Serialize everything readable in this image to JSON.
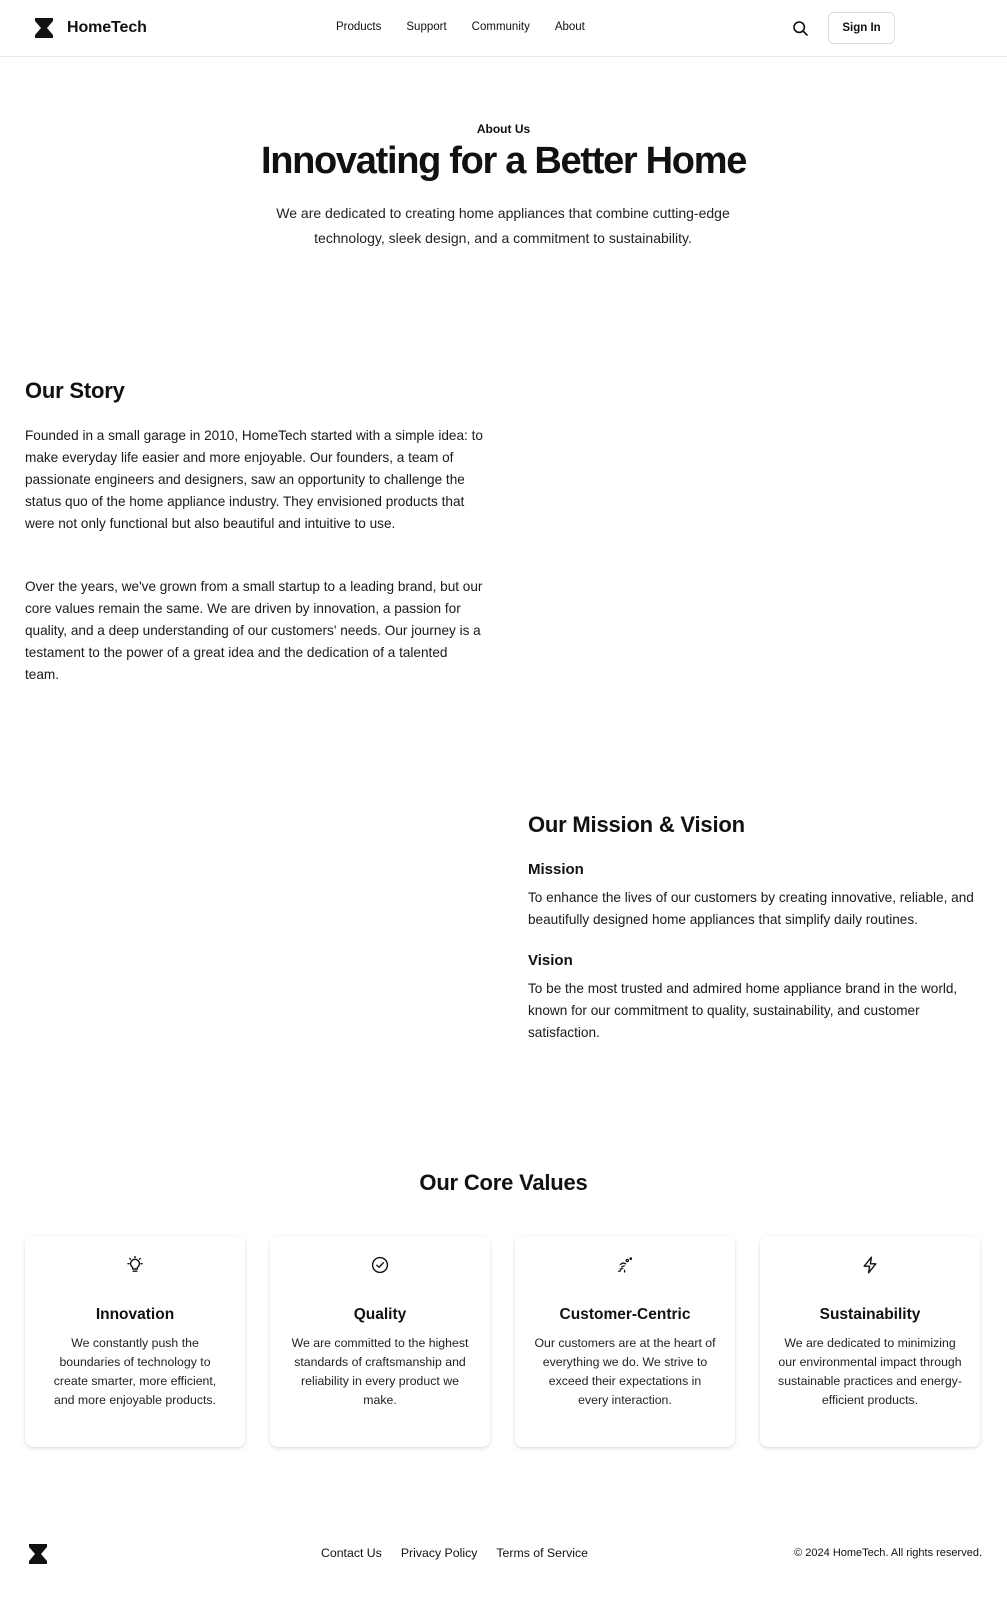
{
  "brand": {
    "name": "HomeTech",
    "logo_icon": "hourglass-logo-icon"
  },
  "nav": {
    "items": [
      {
        "label": "Products"
      },
      {
        "label": "Support"
      },
      {
        "label": "Community"
      },
      {
        "label": "About"
      }
    ],
    "search_icon": "search-icon",
    "signin_label": "Sign In"
  },
  "hero": {
    "eyebrow": "About Us",
    "title": "Innovating for a Better Home",
    "subtitle": "We are dedicated to creating home appliances that combine cutting-edge technology, sleek design, and a commitment to sustainability."
  },
  "story": {
    "title": "Our Story",
    "paragraphs": [
      "Founded in a small garage in 2010, HomeTech started with a simple idea: to make everyday life easier and more enjoyable. Our founders, a team of passionate engineers and designers, saw an opportunity to challenge the status quo of the home appliance industry. They envisioned products that were not only functional but also beautiful and intuitive to use.",
      "Over the years, we've grown from a small startup to a leading brand, but our core values remain the same. We are driven by innovation, a passion for quality, and a deep understanding of our customers' needs. Our journey is a testament to the power of a great idea and the dedication of a talented team."
    ]
  },
  "mission_vision": {
    "title": "Our Mission & Vision",
    "mission_heading": "Mission",
    "mission_text": "To enhance the lives of our customers by creating innovative, reliable, and beautifully designed home appliances that simplify daily routines.",
    "vision_heading": "Vision",
    "vision_text": "To be the most trusted and admired home appliance brand in the world, known for our commitment to quality, sustainability, and customer satisfaction."
  },
  "values": {
    "title": "Our Core Values",
    "cards": [
      {
        "icon": "lightbulb-icon",
        "title": "Innovation",
        "description": "We constantly push the boundaries of technology to create smarter, more efficient, and more enjoyable products."
      },
      {
        "icon": "check-circle-icon",
        "title": "Quality",
        "description": "We are committed to the highest standards of craftsmanship and reliability in every product we make."
      },
      {
        "icon": "handshake-icon",
        "title": "Customer-Centric",
        "description": "Our customers are at the heart of everything we do. We strive to exceed their expectations in every interaction."
      },
      {
        "icon": "lightning-icon",
        "title": "Sustainability",
        "description": "We are dedicated to minimizing our environmental impact through sustainable practices and energy-efficient products."
      }
    ]
  },
  "footer": {
    "links": [
      {
        "label": "Contact Us"
      },
      {
        "label": "Privacy Policy"
      },
      {
        "label": "Terms of Service"
      }
    ],
    "copyright": "© 2024 HomeTech. All rights reserved."
  }
}
